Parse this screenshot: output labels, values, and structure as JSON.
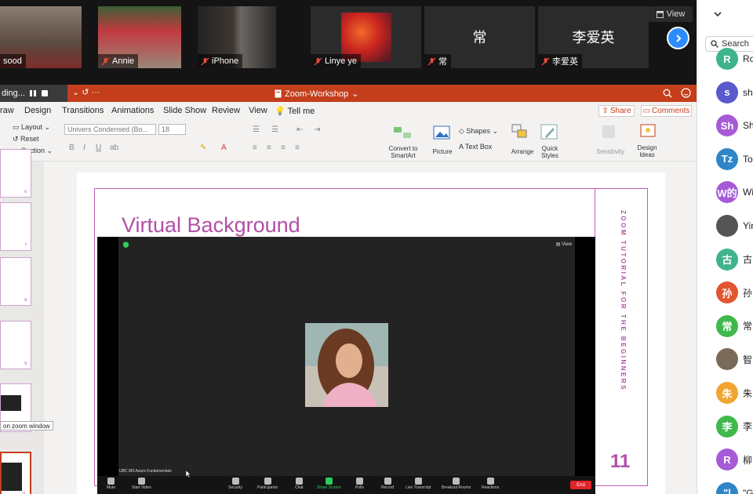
{
  "gallery": {
    "tiles": [
      {
        "name": "sood",
        "muted": false
      },
      {
        "name": "Annie",
        "muted": true
      },
      {
        "name": "iPhone",
        "muted": true
      },
      {
        "name": "Linye ye",
        "muted": true
      },
      {
        "name": "常",
        "display": "常",
        "muted": true
      },
      {
        "name": "李爱英",
        "display": "李爱英",
        "muted": true
      }
    ],
    "view_label": "View"
  },
  "participants_panel": {
    "search_placeholder": "Search",
    "people": [
      {
        "initials": "R",
        "label": "Ro",
        "color": "#3fb38c"
      },
      {
        "initials": "s",
        "label": "sh",
        "color": "#5a5acd"
      },
      {
        "initials": "Sh",
        "label": "Sh",
        "color": "#a65ad6"
      },
      {
        "initials": "Tz",
        "label": "To",
        "color": "#2e86c9"
      },
      {
        "initials": "W的",
        "label": "Wil",
        "color": "#a65ad6"
      },
      {
        "initials": "",
        "label": "Yir",
        "color": "#555555"
      },
      {
        "initials": "古",
        "label": "古",
        "color": "#3fb38c"
      },
      {
        "initials": "孙",
        "label": "孙",
        "color": "#e0552f"
      },
      {
        "initials": "常",
        "label": "常",
        "color": "#3fb84c"
      },
      {
        "initials": "",
        "label": "智",
        "color": "#7a6a5a"
      },
      {
        "initials": "朱",
        "label": "朱",
        "color": "#f2a431"
      },
      {
        "initials": "李",
        "label": "李",
        "color": "#3fb84c"
      },
      {
        "initials": "R",
        "label": "柳",
        "color": "#a65ad6"
      },
      {
        "initials": "\"|",
        "label": "\"G",
        "color": "#2e86c9"
      }
    ]
  },
  "ppt": {
    "recording_label": "ding...",
    "doc_title": "Zoom-Workshop",
    "tabs": [
      "raw",
      "Design",
      "Transitions",
      "Animations",
      "Slide Show",
      "Review",
      "View",
      "Tell me"
    ],
    "share_label": "Share",
    "comments_label": "Comments",
    "ribbon": {
      "layout": "Layout",
      "reset": "Reset",
      "section": "Section",
      "font_name": "Univers Condensed (Bo...",
      "font_size": "18",
      "convert": "Convert to SmartArt",
      "picture": "Picture",
      "shapes": "Shapes",
      "text_box": "Text Box",
      "arrange": "Arrange",
      "quick_styles": "Quick Styles",
      "sensitivity": "Sensitivity",
      "design_ideas": "Design Ideas"
    },
    "thumb_tooltip": "on zoom window",
    "thumb_numbers": [
      "6",
      "7",
      "8",
      "9",
      "10",
      "11"
    ]
  },
  "slide": {
    "title": "Virtual Background",
    "side_text": "ZOOM TUTORIAL FOR THE BEGINNERS",
    "number": "11",
    "embedded_zoom": {
      "session_label": "UBC MS Azure Fundamentals",
      "view_label": "View",
      "toolbar": [
        "Mute",
        "Start Video",
        "Security",
        "Participants",
        "Chat",
        "Share Screen",
        "Polls",
        "Record",
        "Live Transcript",
        "Breakout Rooms",
        "Reactions"
      ],
      "end_label": "End"
    }
  },
  "colors": {
    "accent": "#b24fa8",
    "ppt_red": "#c43e1c",
    "zoom_blue": "#2d8cff"
  }
}
